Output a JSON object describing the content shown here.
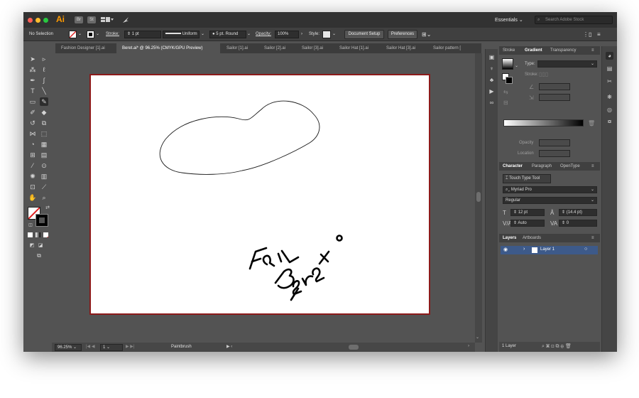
{
  "app": {
    "logo": "Ai",
    "workspace": "Essentials",
    "search_placeholder": "Search Adobe Stock",
    "buttons": {
      "br": "Br",
      "st": "St"
    }
  },
  "control_bar": {
    "selection": "No Selection",
    "stroke_label": "Stroke:",
    "stroke_value": "1 pt",
    "profile": "Uniform",
    "brush": "5 pt. Round",
    "opacity_label": "Opacity:",
    "opacity_value": "100%",
    "style_label": "Style:",
    "document_setup": "Document Setup",
    "preferences": "Preferences"
  },
  "tabs": [
    "Fashion Designer [1].ai",
    "Beret.ai* @ 96.25% (CMYK/GPU Preview)",
    "Sailor [1].ai",
    "Sailor [2].ai",
    "Sailor [3].ai",
    "Sailor Hat [1].ai",
    "Sailor Hat [3].ai",
    "Sailor pattern ["
  ],
  "status": {
    "zoom": "96.25%",
    "artboard_number": "1",
    "tool_name": "Paintbrush"
  },
  "gradient_panel": {
    "tabs": [
      "Stroke",
      "Gradient",
      "Transparency"
    ],
    "type_label": "Type:",
    "stroke_label": "Stroke:",
    "opacity_label": "Opacity",
    "location_label": "Location"
  },
  "character_panel": {
    "tabs": [
      "Character",
      "Paragraph",
      "OpenType"
    ],
    "touch_type": "Touch Type Tool",
    "font": "Myriad Pro",
    "style": "Regular",
    "size": "12 pt",
    "leading": "(14.4 pt)",
    "kerning": "Auto",
    "tracking": "0"
  },
  "layers_panel": {
    "tabs": [
      "Layers",
      "Artboards"
    ],
    "layer_name": "Layer 1",
    "footer": "1 Layer"
  },
  "colors": {
    "artboard_border": "#8c1a1a",
    "ui_bg": "#535353",
    "accent": "#ff9a00",
    "layer_highlight": "#3d5a8a"
  }
}
